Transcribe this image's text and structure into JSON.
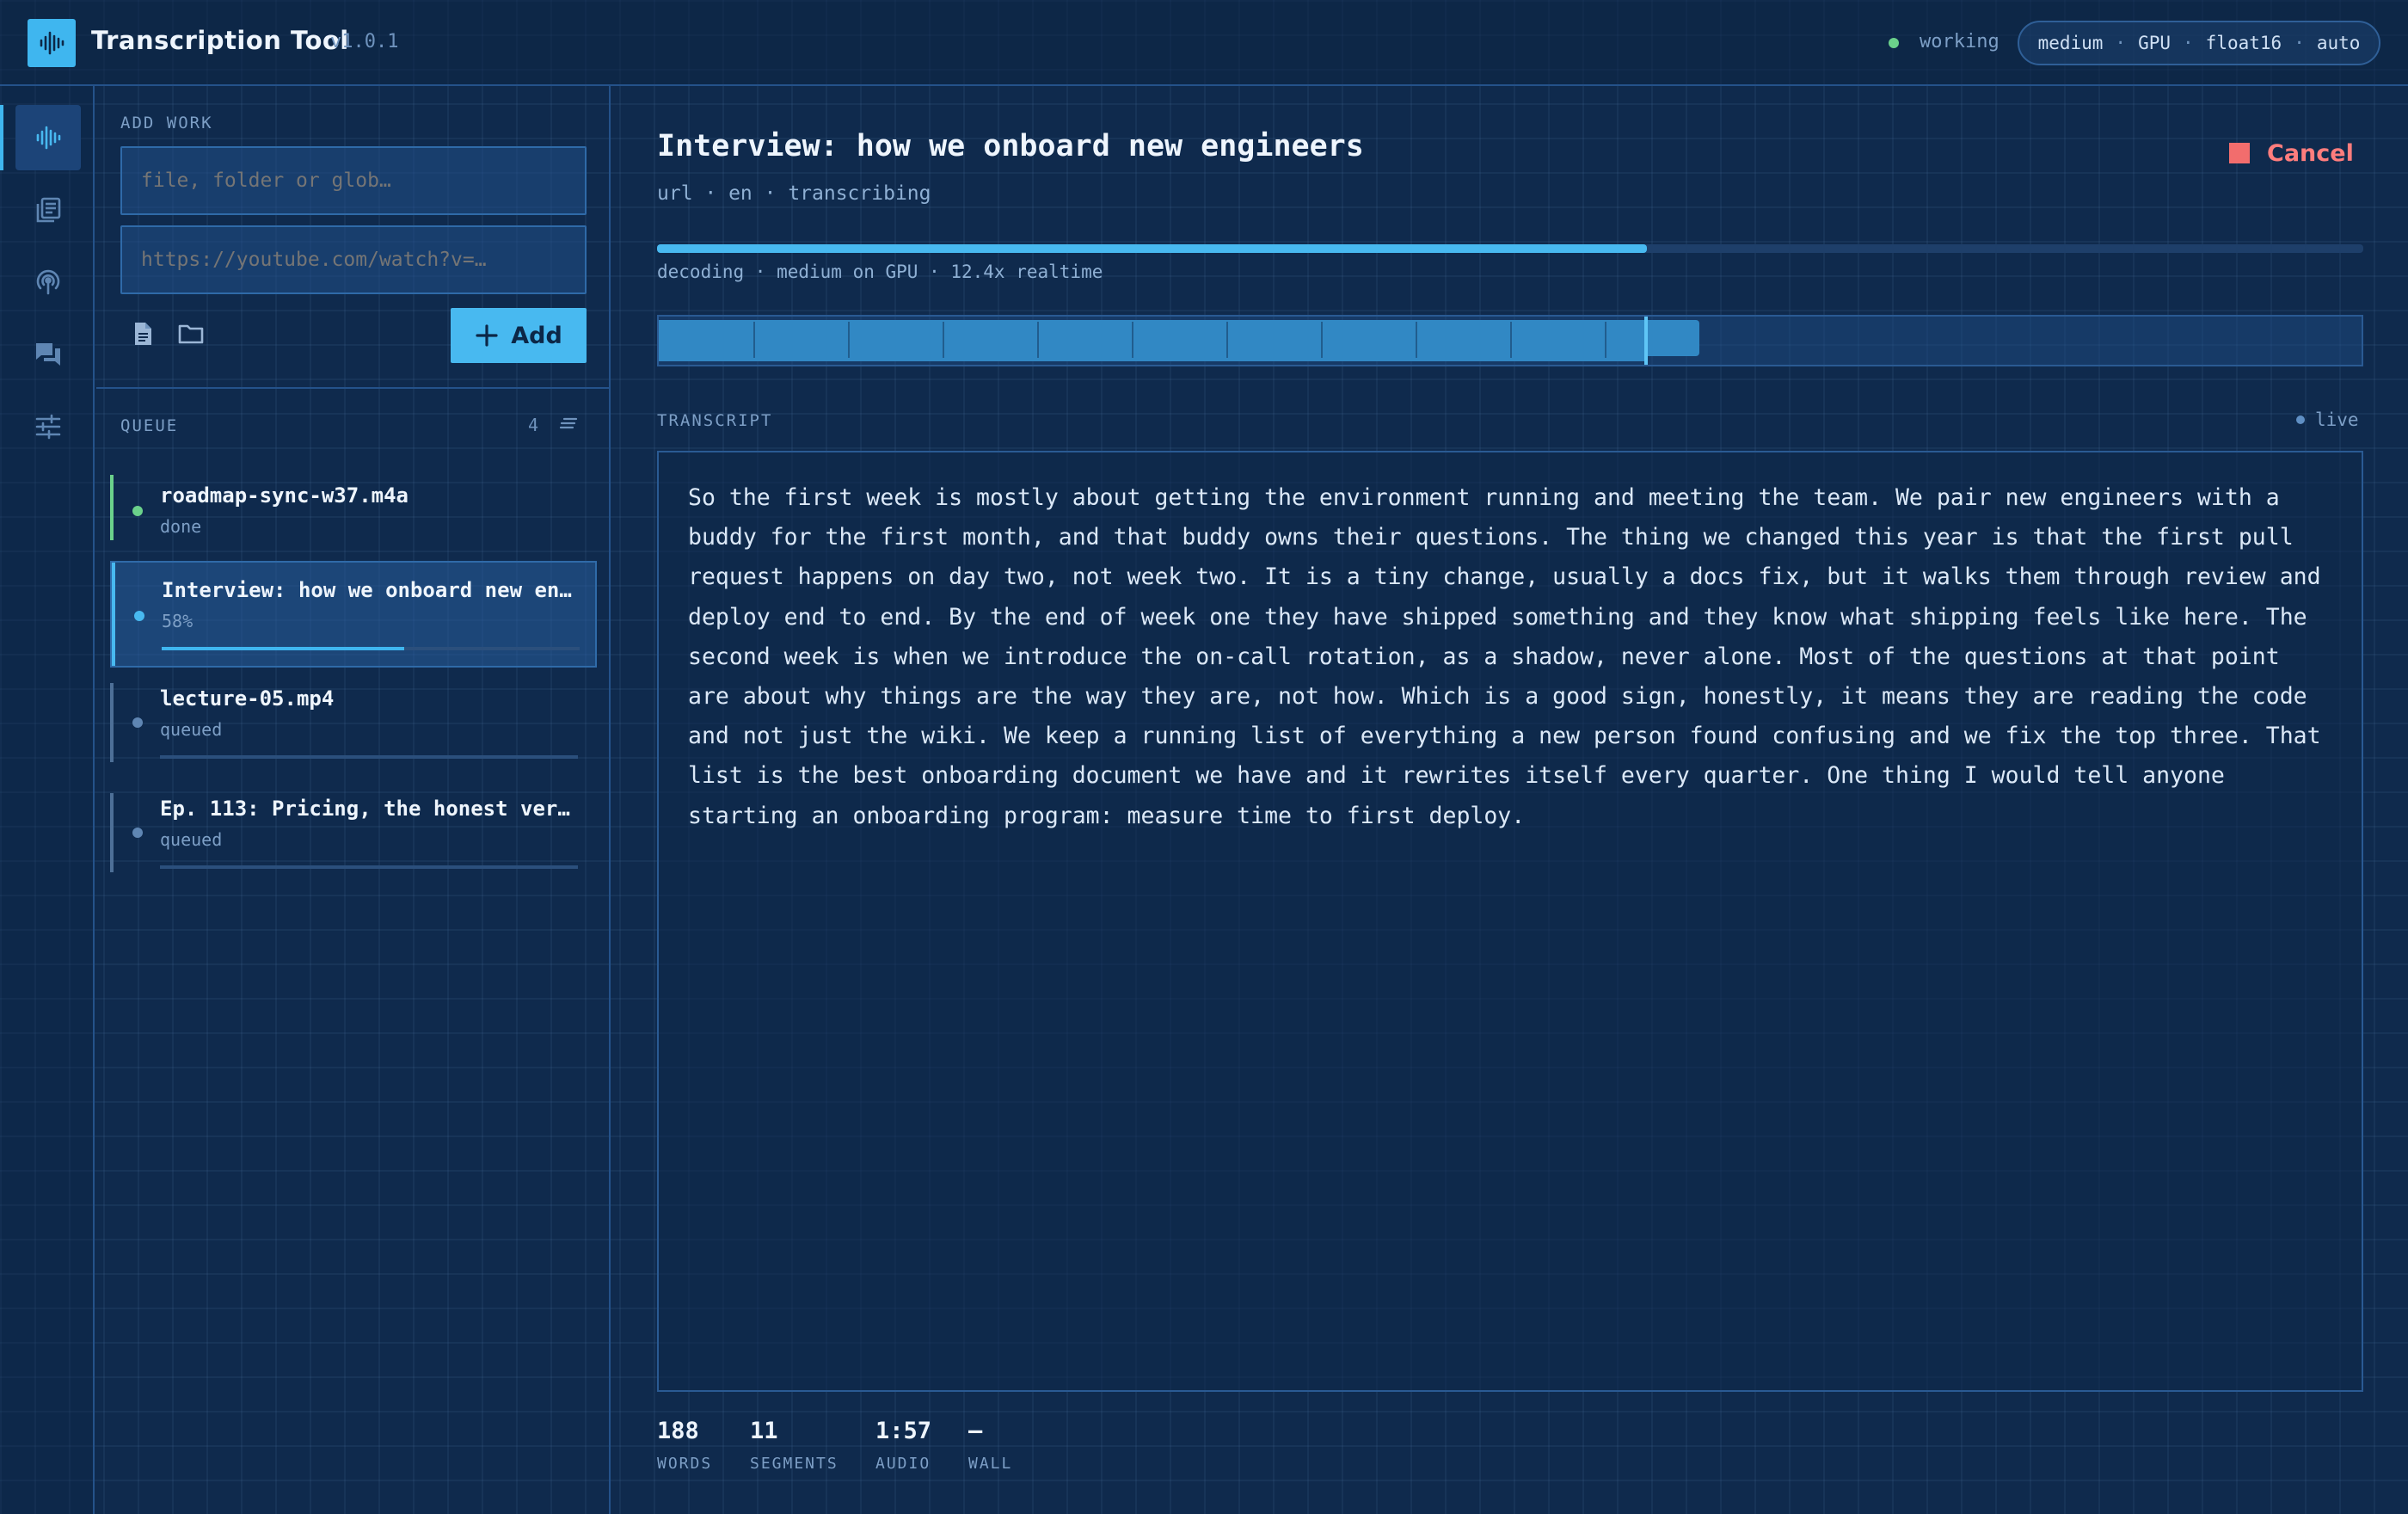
{
  "header": {
    "title": "Transcription Tool",
    "version": "v1.0.1",
    "status": "working",
    "model_pill": [
      "medium",
      "GPU",
      "float16",
      "auto"
    ],
    "model_pill_separator": "·"
  },
  "rail": {
    "items": [
      {
        "icon": "waveform-icon",
        "active": true
      },
      {
        "icon": "library-icon",
        "active": false
      },
      {
        "icon": "podcast-icon",
        "active": false
      },
      {
        "icon": "chat-icon",
        "active": false
      },
      {
        "icon": "sliders-icon",
        "active": false
      }
    ]
  },
  "add_work": {
    "label": "ADD WORK",
    "path_placeholder": "file, folder or glob…",
    "url_placeholder": "https://youtube.com/watch?v=…",
    "add_label": "Add"
  },
  "queue": {
    "label": "QUEUE",
    "count": "4",
    "items": [
      {
        "name": "roadmap-sync-w37.m4a",
        "status": "done",
        "progress": 1.0
      },
      {
        "name": "Interview: how we onboard new en…",
        "status": "58%",
        "progress": 0.58
      },
      {
        "name": "lecture-05.mp4",
        "status": "queued",
        "progress": 0
      },
      {
        "name": "Ep. 113: Pricing, the honest ver…",
        "status": "queued",
        "progress": 0
      }
    ]
  },
  "job": {
    "title": "Interview: how we onboard new engineers",
    "meta": "url · en · transcribing",
    "cancel_label": "Cancel",
    "progress": 0.58,
    "decode_status": "decoding · medium on GPU · 12.4x realtime",
    "waveform_played": 0.58,
    "waveform_buffered": 0.611
  },
  "transcript": {
    "label": "TRANSCRIPT",
    "live_label": "live",
    "text": "So the first week is mostly about getting the environment running and meeting the team. We pair new engineers with a buddy for the first month, and that buddy owns their questions. The thing we changed this year is that the first pull request happens on day two, not week two. It is a tiny change, usually a docs fix, but it walks them through review and deploy end to end. By the end of week one they have shipped something and they know what shipping feels like here. The second week is when we introduce the on-call rotation, as a shadow, never alone. Most of the questions at that point are about why things are the way they are, not how. Which is a good sign, honestly, it means they are reading the code and not just the wiki. We keep a running list of everything a new person found confusing and we fix the top three. That list is the best onboarding document we have and it rewrites itself every quarter. One thing I would tell anyone starting an onboarding program: measure time to first deploy."
  },
  "stats": [
    {
      "value": "188",
      "label": "WORDS"
    },
    {
      "value": "11",
      "label": "SEGMENTS"
    },
    {
      "value": "1:57",
      "label": "AUDIO"
    },
    {
      "value": "—",
      "label": "WALL"
    }
  ],
  "colors": {
    "accent": "#48b9f0",
    "done": "#6bd18b",
    "cancel": "#ff7d7d",
    "background": "#0f2a4d"
  }
}
